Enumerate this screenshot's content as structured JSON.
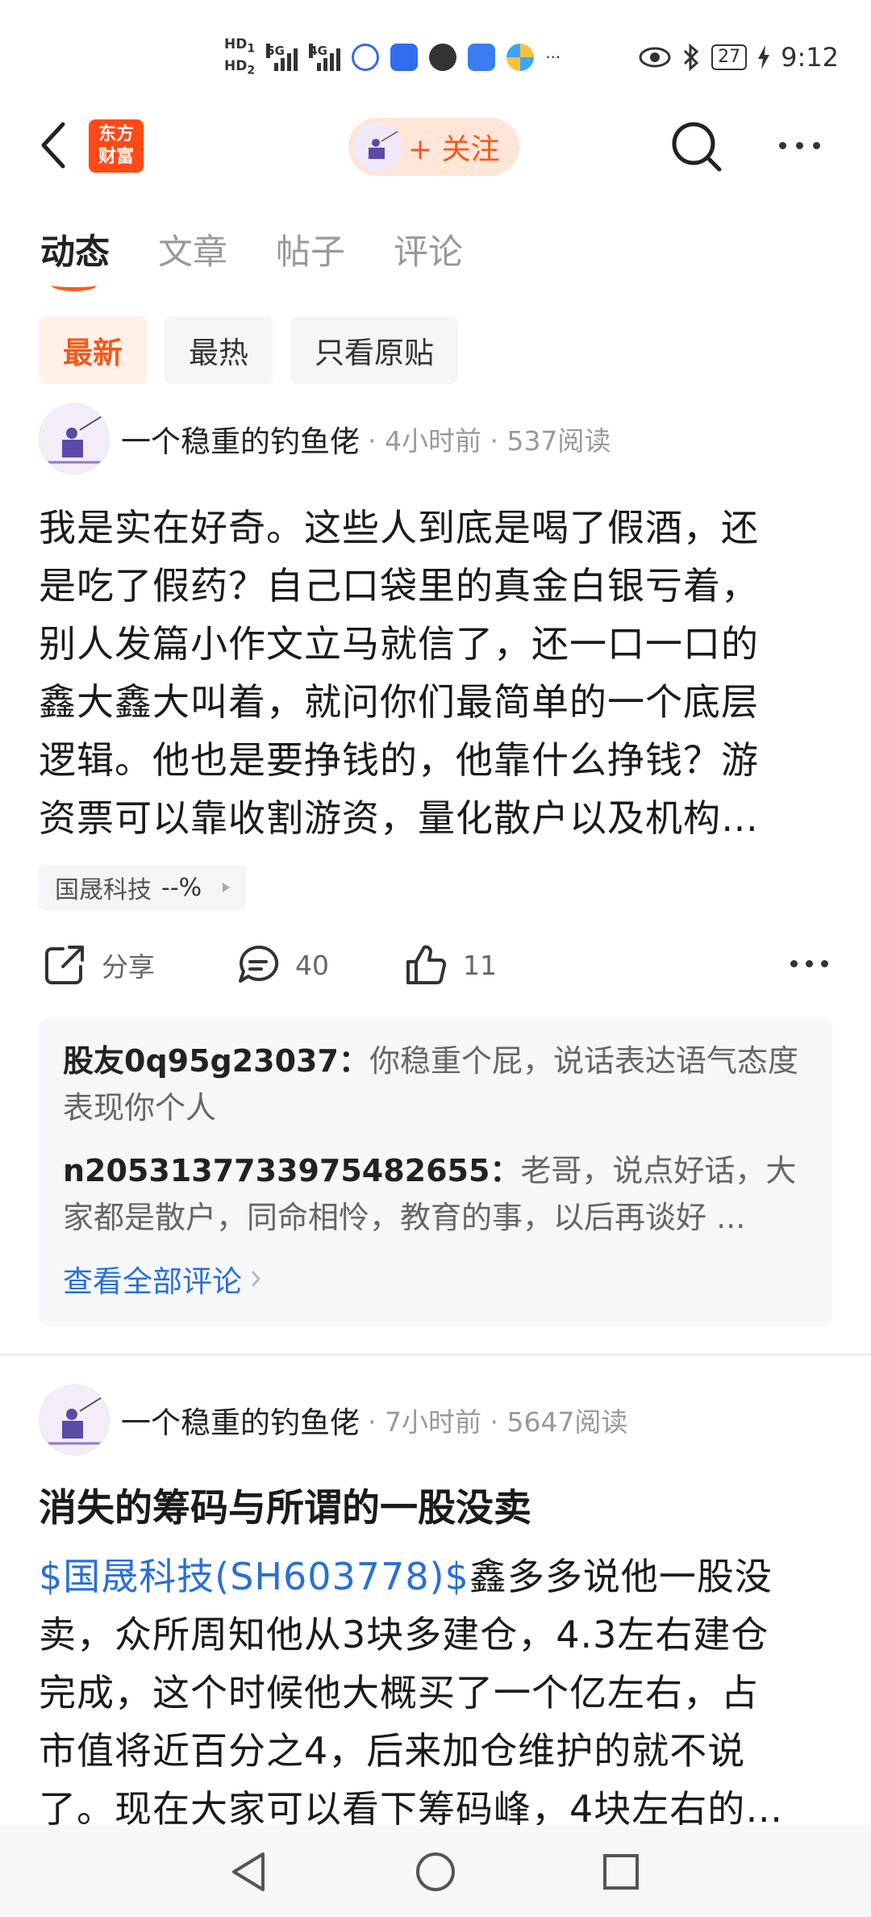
{
  "status_bar": {
    "hd1": "HD",
    "hd1_num": "1",
    "hd2": "HD",
    "hd2_num": "2",
    "net1": "5G",
    "net2": "4G",
    "dots": "···",
    "battery": "27",
    "time": "9:12"
  },
  "header": {
    "logo_line1": "东方",
    "logo_line2": "财富",
    "follow_label": "+ 关注"
  },
  "tabs": [
    "动态",
    "文章",
    "帖子",
    "评论"
  ],
  "filters": [
    "最新",
    "最热",
    "只看原贴"
  ],
  "post1": {
    "author": "一个稳重的钓鱼佬",
    "meta": "· 4小时前 · 537阅读",
    "lines": [
      "我是实在好奇。这些人到底是喝了假酒，还",
      "是吃了假药？自己口袋里的真金白银亏着，",
      "别人发篇小作文立马就信了，还一口一口的",
      "鑫大鑫大叫着，就问你们最简单的一个底层",
      "逻辑。他也是要挣钱的，他靠什么挣钱？游",
      "资票可以靠收割游资，量化散户以及机构…"
    ],
    "stock_tag": "国晟科技",
    "stock_change": "--%",
    "share_label": "分享",
    "comment_count": "40",
    "like_count": "11",
    "comments": [
      {
        "user": "股友0q95g23037：",
        "text": "你稳重个屁，说话表达语气态度表现你个人"
      },
      {
        "user": "n2053137733975482655：",
        "text": "老哥，说点好话，大家都是散户，同命相怜，教育的事，以后再谈好 ..."
      }
    ],
    "view_all": "查看全部评论"
  },
  "post2": {
    "author": "一个稳重的钓鱼佬",
    "meta": "· 7小时前 · 5647阅读",
    "title": "消失的筹码与所谓的一股没卖",
    "link": "$国晟科技(SH603778)$",
    "line1_rest": "鑫多多说他一股没",
    "lines": [
      "卖，众所周知他从3块多建仓，4.3左右建仓",
      "完成，这个时候他大概买了一个亿左右，占",
      "市值将近百分之4，后来加仓维护的就不说",
      "了。现在大家可以看下筹码峰，4块左右的…"
    ]
  },
  "colors": {
    "accent": "#f05a1e",
    "link": "#2a6fd6",
    "logo_bg": "#ff4a17"
  }
}
